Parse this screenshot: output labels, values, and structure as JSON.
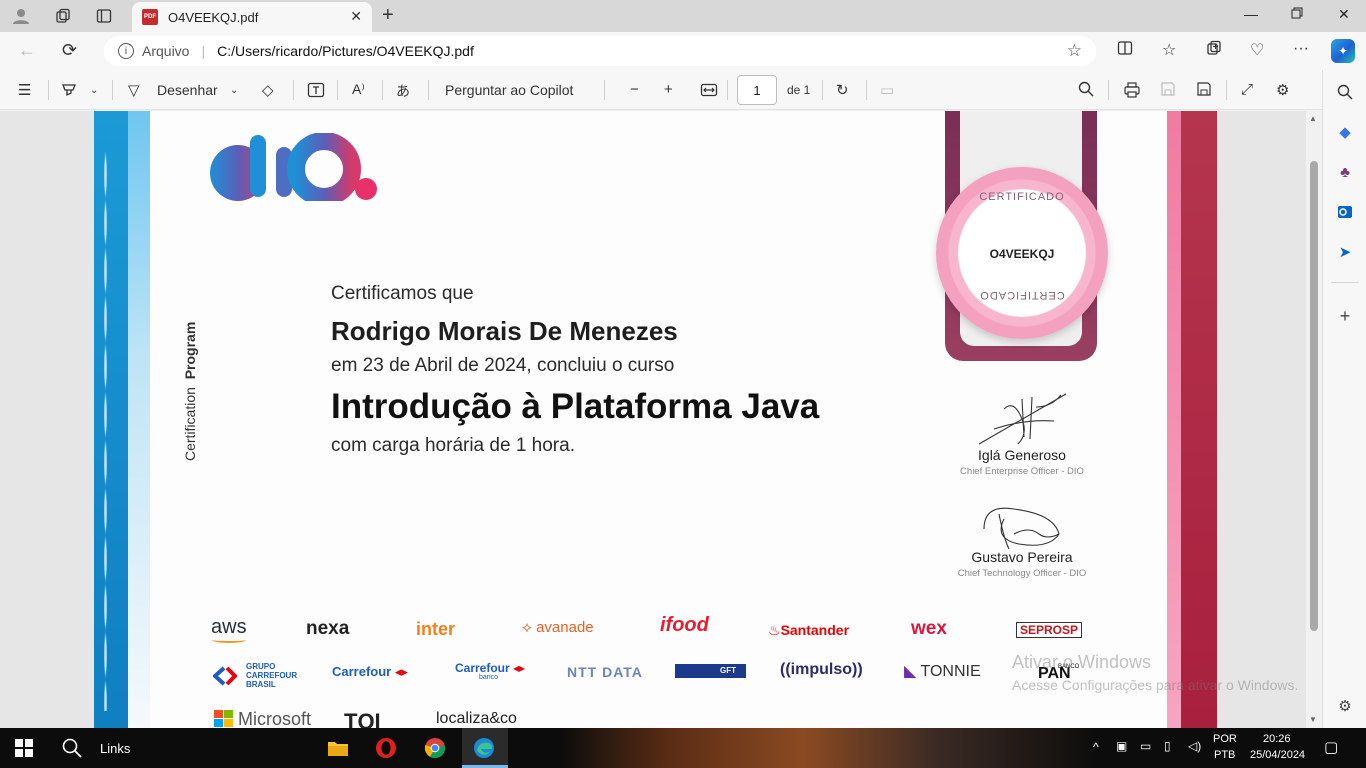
{
  "browser": {
    "tab_title": "O4VEEKQJ.pdf",
    "pdf_badge": "PDF",
    "address_scheme": "Arquivo",
    "address_path": "C:/Users/ricardo/Pictures/O4VEEKQJ.pdf"
  },
  "pdf_toolbar": {
    "draw_label": "Desenhar",
    "ask_copilot_label": "Perguntar ao Copilot",
    "page_number": "1",
    "page_of": "de 1"
  },
  "certificate": {
    "side_text_a": "Certification",
    "side_text_b": "Program",
    "intro": "Certificamos que",
    "name": "Rodrigo Morais De Menezes",
    "date_line": "em 23 de Abril de 2024, concluiu o curso",
    "course": "Introdução à Plataforma Java",
    "hours_line": "com carga horária de 1 hora.",
    "seal_top": "CERTIFICADO",
    "seal_code": "O4VEEKQJ",
    "seal_bottom": "CERTIFICADO",
    "signers": [
      {
        "name": "Iglá Generoso",
        "role": "Chief Enterprise Officer - DIO"
      },
      {
        "name": "Gustavo Pereira",
        "role": "Chief Technology Officer - DIO"
      }
    ],
    "partners_row1": [
      "aws",
      "nexa",
      "inter",
      "avanade",
      "ifood",
      "Santander",
      "wex",
      "SEPROSP"
    ],
    "partners_row2": [
      "GRUPO CARREFOUR BRASIL",
      "Carrefour",
      "Carrefour",
      "NTT DATA",
      "GFT",
      "((impulso))",
      "TONNIE",
      "PAN"
    ],
    "partners_row2_sub": [
      "",
      "",
      "banco",
      "",
      "",
      "",
      "",
      "BANCO"
    ],
    "partners_row3": [
      "Microsoft",
      "TQI",
      "localiza&co"
    ]
  },
  "watermark": {
    "line1": "Ativar o Windows",
    "line2": "Acesse Configurações para ativar o Windows."
  },
  "taskbar": {
    "search_label": "Links",
    "lang_top": "POR",
    "lang_bottom": "PTB",
    "time": "20:26",
    "date": "25/04/2024"
  },
  "colors": {
    "dio_blue": "#1b9ad6",
    "dio_pink": "#e8306a",
    "ribbon": "#7a2e55",
    "edge_accent": "#0c59a4"
  }
}
